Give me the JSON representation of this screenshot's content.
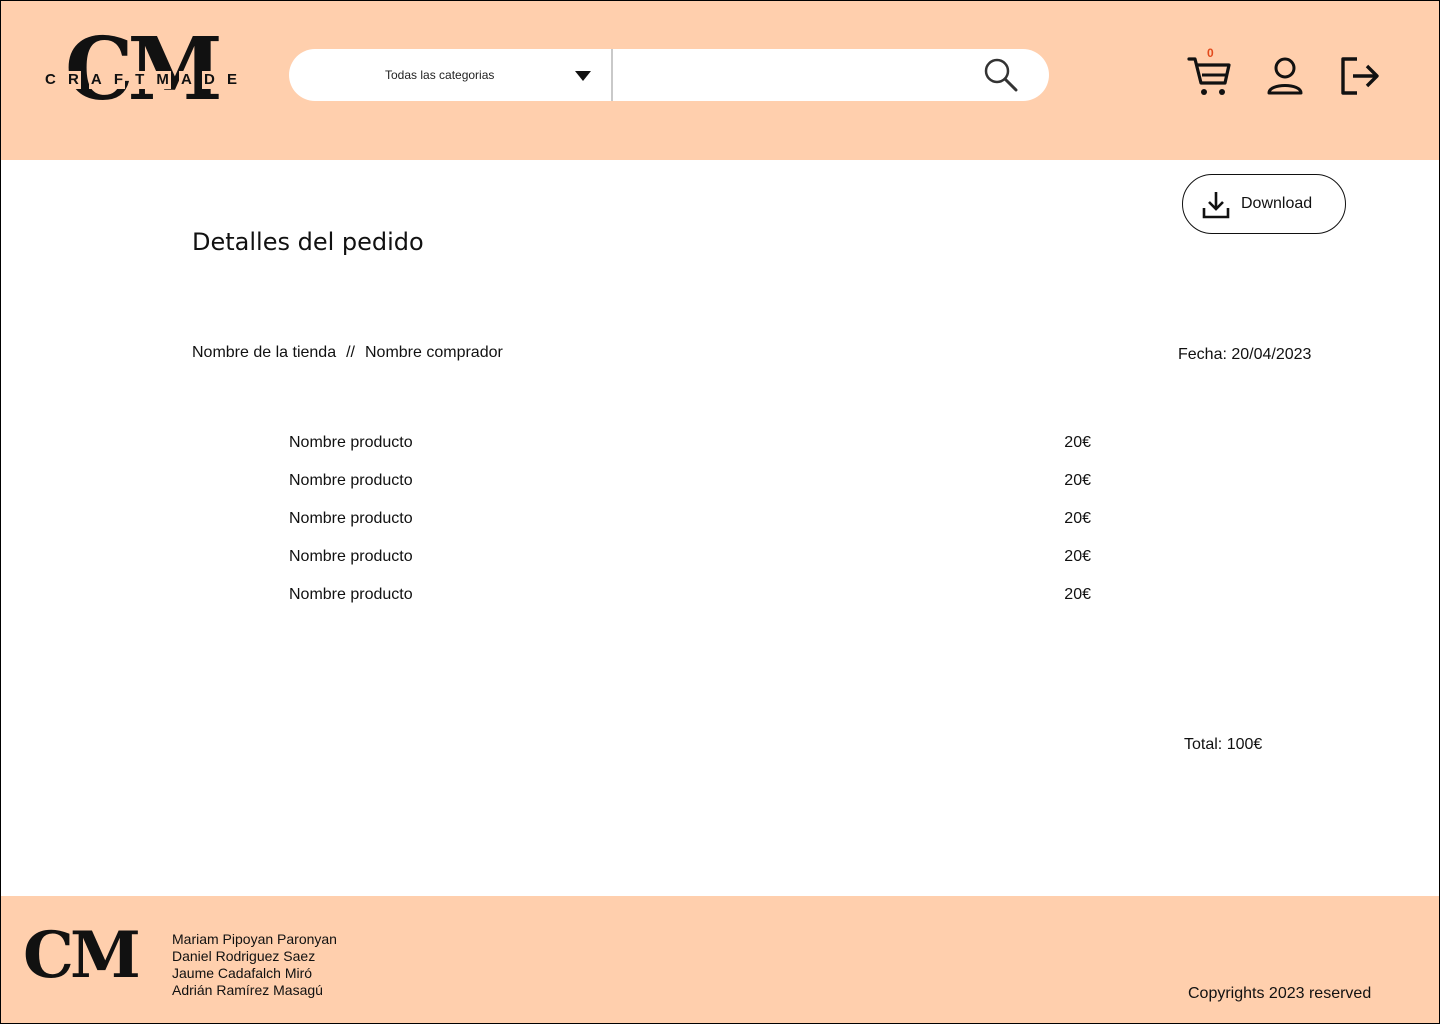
{
  "header": {
    "logo_mark": "CM",
    "logo_tagline": [
      "C",
      "R",
      "A",
      "F",
      "T",
      "M",
      "A",
      "D",
      "E"
    ],
    "category_select": "Todas las categorias",
    "search_placeholder": "",
    "cart_count": "0"
  },
  "order": {
    "title": "Detalles del pedido",
    "download_label": "Download",
    "store_name": "Nombre de la tienda",
    "separator": "//",
    "buyer_name": "Nombre comprador",
    "date": "Fecha: 20/04/2023",
    "items": [
      {
        "name": "Nombre producto",
        "price": "20€"
      },
      {
        "name": "Nombre producto",
        "price": "20€"
      },
      {
        "name": "Nombre producto",
        "price": "20€"
      },
      {
        "name": "Nombre producto",
        "price": "20€"
      },
      {
        "name": "Nombre producto",
        "price": "20€"
      }
    ],
    "total": "Total: 100€"
  },
  "footer": {
    "logo_mark": "CM",
    "authors": [
      "Mariam Pipoyan Paronyan",
      "Daniel Rodriguez Saez",
      "Jaume Cadafalch Miró",
      "Adrián Ramírez Masagú"
    ],
    "copyright": "Copyrights 2023 reserved"
  },
  "colors": {
    "header_bg": "#ffcfad",
    "cart_badge": "#e24a1c"
  },
  "icons": [
    "search-icon",
    "cart-icon",
    "user-icon",
    "logout-icon",
    "download-icon",
    "chevron-down-icon"
  ]
}
